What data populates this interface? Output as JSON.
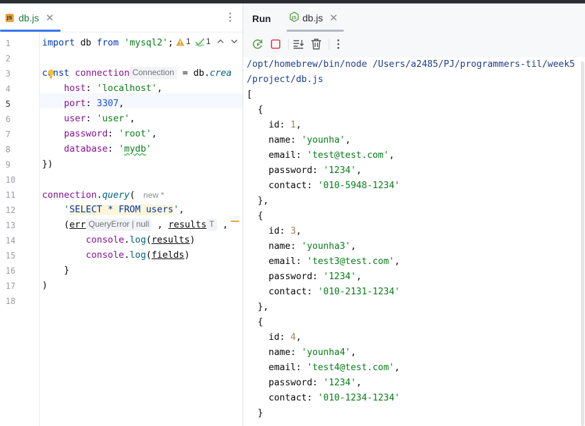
{
  "editor": {
    "tab": {
      "label": "db.js",
      "icon": "js-file-icon",
      "close": "✕"
    },
    "more": "⋮",
    "inspections": {
      "warnings": "1",
      "weak": "1"
    },
    "line_numbers": [
      "1",
      "2",
      "3",
      "4",
      "5",
      "6",
      "7",
      "8",
      "9",
      "10",
      "11",
      "12",
      "13",
      "14",
      "15",
      "16",
      "17",
      "18"
    ],
    "current_line": "5",
    "code": {
      "l1": {
        "kw": "import",
        "id": " db ",
        "kw2": "from",
        "sp": " ",
        "str": "'mysql2'",
        "end": ";"
      },
      "l3": {
        "kw": "const",
        "sp": " ",
        "var": "connection",
        "hint": "Connection",
        "rest": " = db.",
        "fn": "crea"
      },
      "l4": {
        "indent": "    ",
        "prop": "host",
        "colon": ": ",
        "str": "'localhost'",
        "end": ","
      },
      "l5": {
        "indent": "    ",
        "prop": "port",
        "colon": ": ",
        "num": "3307",
        "end": ","
      },
      "l6": {
        "indent": "    ",
        "prop": "user",
        "colon": ": ",
        "str": "'user'",
        "end": ","
      },
      "l7": {
        "indent": "    ",
        "prop": "password",
        "colon": ": ",
        "str": "'root'",
        "end": ","
      },
      "l8": {
        "indent": "    ",
        "prop": "database",
        "colon": ": ",
        "str_a": "'",
        "str_b": "mydb",
        "str_c": "'"
      },
      "l9": {
        "text": "})"
      },
      "l11": {
        "var": "connection",
        "dot": ".",
        "fn": "query",
        "paren": "(",
        "hint": "new *"
      },
      "l12": {
        "indent": "    ",
        "q1": "'",
        "sql": "SELECT * FROM users",
        "q2": "'",
        "end": ","
      },
      "l13": {
        "indent": "    ",
        "paren": "(",
        "p1": "err",
        "hint1": "QueryError | null",
        "sep": " , ",
        "p2": "results",
        "hint2": "T",
        "end": " ,"
      },
      "l14": {
        "indent": "        ",
        "obj": "console",
        "dot": ".",
        "fn": "log",
        "open": "(",
        "arg": "results",
        "close": ")"
      },
      "l15": {
        "indent": "        ",
        "obj": "console",
        "dot": ".",
        "fn": "log",
        "open": "(",
        "arg": "fields",
        "close": ")"
      },
      "l16": {
        "indent": "    ",
        "text": "}"
      },
      "l17": {
        "text": ")"
      }
    }
  },
  "run": {
    "title": "Run",
    "tab": {
      "label": "db.js",
      "icon": "nodejs-icon",
      "close": "✕"
    },
    "toolbar": [
      "rerun-icon",
      "stop-icon",
      "scroll-to-end-icon",
      "clear-icon",
      "more-icon"
    ],
    "console": {
      "path1": "/opt/homebrew/bin/node /Users/a2485/PJ/programmers-til/week5",
      "path2": "/project/db.js",
      "open_bracket": "[",
      "records": [
        {
          "id": "1",
          "name": "'younha'",
          "email": "'test@test.com'",
          "password": "'1234'",
          "contact": "'010-5948-1234'",
          "close": "},"
        },
        {
          "id": "3",
          "name": "'younha3'",
          "email": "'test3@test.com'",
          "password": "'1234'",
          "contact": "'010-2131-1234'",
          "close": "},"
        },
        {
          "id": "4",
          "name": "'younha4'",
          "email": "'test4@test.com'",
          "password": "'1234'",
          "contact": "'010-1234-1234'",
          "close": "}"
        }
      ],
      "keys": {
        "id": "id: ",
        "name": "name: ",
        "email": "email: ",
        "password": "password: ",
        "contact": "contact: "
      },
      "open_brace": "{",
      "comma": ","
    }
  }
}
